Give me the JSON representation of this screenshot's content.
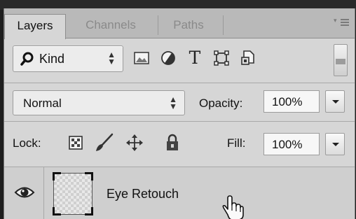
{
  "tabs": [
    {
      "label": "Layers",
      "active": true
    },
    {
      "label": "Channels",
      "active": false
    },
    {
      "label": "Paths",
      "active": false
    }
  ],
  "filter": {
    "kind_label": "Kind",
    "type_icon_glyph": "T"
  },
  "blend": {
    "mode": "Normal",
    "opacity_label": "Opacity:",
    "opacity_value": "100%"
  },
  "lock": {
    "label": "Lock:",
    "fill_label": "Fill:",
    "fill_value": "100%"
  },
  "layer": {
    "name": "Eye Retouch",
    "visible": true
  },
  "icons": [
    "panel-menu-icon",
    "search-icon",
    "image-filter-icon",
    "adjustment-filter-icon",
    "type-filter-icon",
    "shape-filter-icon",
    "smart-object-filter-icon",
    "filter-toggle-icon",
    "lock-pixels-icon",
    "lock-paint-brush-icon",
    "lock-position-icon",
    "lock-all-icon",
    "eye-icon",
    "hand-cursor-icon"
  ]
}
